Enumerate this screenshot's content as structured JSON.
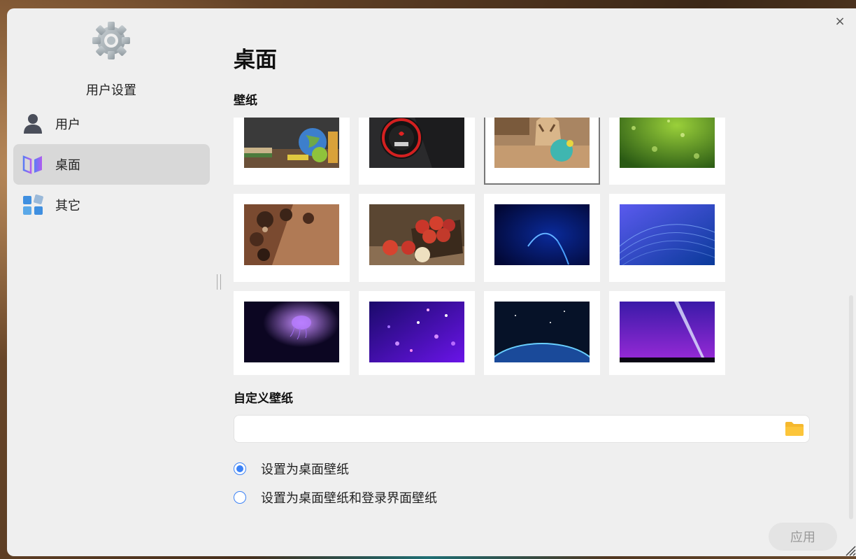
{
  "window": {
    "close_glyph": "×"
  },
  "sidebar": {
    "title": "用户设置",
    "items": [
      {
        "label": "用户",
        "icon": "user-icon",
        "active": false
      },
      {
        "label": "桌面",
        "icon": "desktop-icon",
        "active": true
      },
      {
        "label": "其它",
        "icon": "apps-icon",
        "active": false
      }
    ]
  },
  "main": {
    "title": "桌面",
    "wallpaper_section": "壁纸",
    "custom_section": "自定义壁纸",
    "custom_path_value": "",
    "radio_options": [
      {
        "label": "设置为桌面壁纸",
        "checked": true
      },
      {
        "label": "设置为桌面壁纸和登录界面壁纸",
        "checked": false
      }
    ],
    "apply_label": "应用"
  },
  "wallpapers": [
    {
      "name": "school-supplies",
      "selected": false
    },
    {
      "name": "start-button",
      "selected": false
    },
    {
      "name": "puppy-with-ball",
      "selected": true
    },
    {
      "name": "green-water-drops",
      "selected": false
    },
    {
      "name": "chocolates",
      "selected": false
    },
    {
      "name": "apples-crate",
      "selected": false
    },
    {
      "name": "blue-arc",
      "selected": false
    },
    {
      "name": "blue-waves",
      "selected": false
    },
    {
      "name": "jellyfish",
      "selected": false
    },
    {
      "name": "purple-particles",
      "selected": false
    },
    {
      "name": "planet-horizon",
      "selected": false
    },
    {
      "name": "purple-light-beam",
      "selected": false
    }
  ],
  "colors": {
    "accent": "#3b82f6",
    "active_nav": "#d8d8d8",
    "folder": "#f5b82e"
  }
}
